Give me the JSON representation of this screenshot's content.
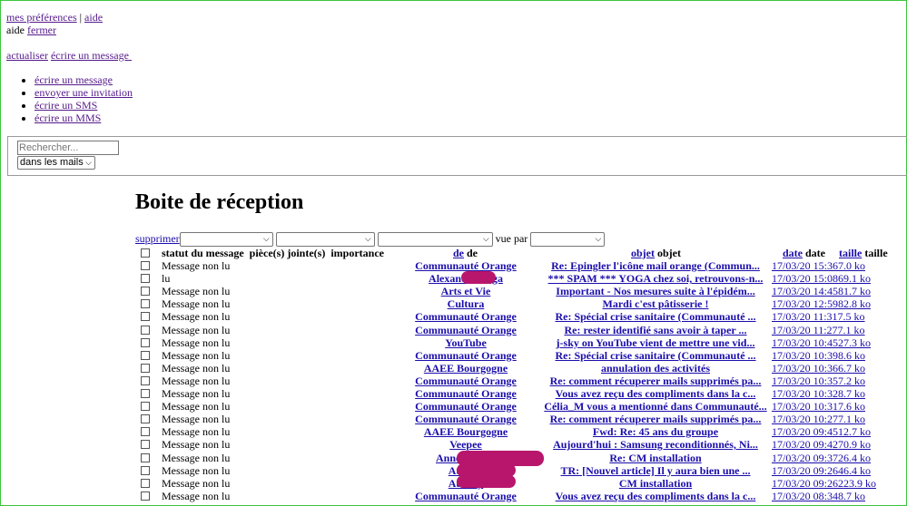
{
  "header": {
    "prefs_link": "mes préférences",
    "separator": "|",
    "help_link": "aide",
    "help_text": "aide",
    "close_link": "fermer"
  },
  "actions": {
    "refresh": "actualiser",
    "write": "écrire un message"
  },
  "new_menu": [
    "écrire un message",
    "envoyer une invitation",
    "écrire un SMS",
    "écrire un MMS"
  ],
  "search": {
    "placeholder": "Rechercher...",
    "scope": "dans les mails"
  },
  "page_title": "Boite de réception",
  "toolbar": {
    "delete": "supprimer",
    "view_by": "vue par"
  },
  "columns": {
    "status": "statut du message",
    "attachments": "pièce(s) jointe(s)",
    "importance": "importance",
    "from_link": "de",
    "from": "de",
    "subject_link": "objet",
    "subject": "objet",
    "date_link": "date",
    "date": "date",
    "size_link": "taille",
    "size": "taille"
  },
  "messages": [
    {
      "status": "Message non lu",
      "from": "Communauté Orange",
      "subject": "Re: Epingler l'icône mail orange (Commun...",
      "datesize": "17/03/20 15:367.0 ko"
    },
    {
      "status": "lu",
      "from": "Alexandra Yoga",
      "subject": "*** SPAM *** YOGA chez soi, retrouvons-n...",
      "datesize": "17/03/20 15:0869.1 ko"
    },
    {
      "status": "Message non lu",
      "from": "Arts et Vie",
      "subject": "Important - Nos mesures suite à l'épidém...",
      "datesize": "17/03/20 14:4581.7 ko"
    },
    {
      "status": "Message non lu",
      "from": "Cultura",
      "subject": "Mardi c'est pâtisserie !",
      "datesize": "17/03/20 12:5982.8 ko"
    },
    {
      "status": "Message non lu",
      "from": "Communauté Orange",
      "subject": "Re: Spécial crise sanitaire (Communauté ...",
      "datesize": "17/03/20 11:317.5 ko"
    },
    {
      "status": "Message non lu",
      "from": "Communauté Orange",
      "subject": "Re: rester identifié sans avoir à taper ...",
      "datesize": "17/03/20 11:277.1 ko"
    },
    {
      "status": "Message non lu",
      "from": "YouTube",
      "subject": "j-sky on YouTube vient de mettre une vid...",
      "datesize": "17/03/20 10:4527.3 ko"
    },
    {
      "status": "Message non lu",
      "from": "Communauté Orange",
      "subject": "Re: Spécial crise sanitaire (Communauté ...",
      "datesize": "17/03/20 10:398.6 ko"
    },
    {
      "status": "Message non lu",
      "from": "AAEE Bourgogne",
      "subject": "annulation des activités",
      "datesize": "17/03/20 10:366.7 ko"
    },
    {
      "status": "Message non lu",
      "from": "Communauté Orange",
      "subject": "Re: comment récuperer mails supprimés pa...",
      "datesize": "17/03/20 10:357.2 ko"
    },
    {
      "status": "Message non lu",
      "from": "Communauté Orange",
      "subject": "Vous avez reçu des compliments dans la c...",
      "datesize": "17/03/20 10:328.7 ko"
    },
    {
      "status": "Message non lu",
      "from": "Communauté Orange",
      "subject": "Célia_M vous a mentionné dans Communauté...",
      "datesize": "17/03/20 10:317.6 ko"
    },
    {
      "status": "Message non lu",
      "from": "Communauté Orange",
      "subject": "Re: comment récuperer mails supprimés pa...",
      "datesize": "17/03/20 10:277.1 ko"
    },
    {
      "status": "Message non lu",
      "from": "AAEE Bourgogne",
      "subject": "Fwd: Re: 45 ans du groupe",
      "datesize": "17/03/20 09:4512.7 ko"
    },
    {
      "status": "Message non lu",
      "from": "Veepee",
      "subject": "Aujourd'hui : Samsung reconditionnés, Ni...",
      "datesize": "17/03/20 09:4270.9 ko"
    },
    {
      "status": "Message non lu",
      "from": "Anne-Sophie",
      "subject": "Re: CM installation",
      "datesize": "17/03/20 09:3726.4 ko"
    },
    {
      "status": "Message non lu",
      "from": "Audrey",
      "subject": "TR: [Nouvel article] Il y aura bien une ...",
      "datesize": "17/03/20 09:2646.4 ko"
    },
    {
      "status": "Message non lu",
      "from": "Audrey",
      "subject": "CM installation",
      "datesize": "17/03/20 09:26223.9 ko"
    },
    {
      "status": "Message non lu",
      "from": "Communauté Orange",
      "subject": "Vous avez reçu des compliments dans la c...",
      "datesize": "17/03/20 08:348.7 ko"
    }
  ],
  "colors": {
    "link": "#1a0dab",
    "visited": "#551a8b",
    "redaction": "#b8166c",
    "frame": "#3cc63c"
  }
}
